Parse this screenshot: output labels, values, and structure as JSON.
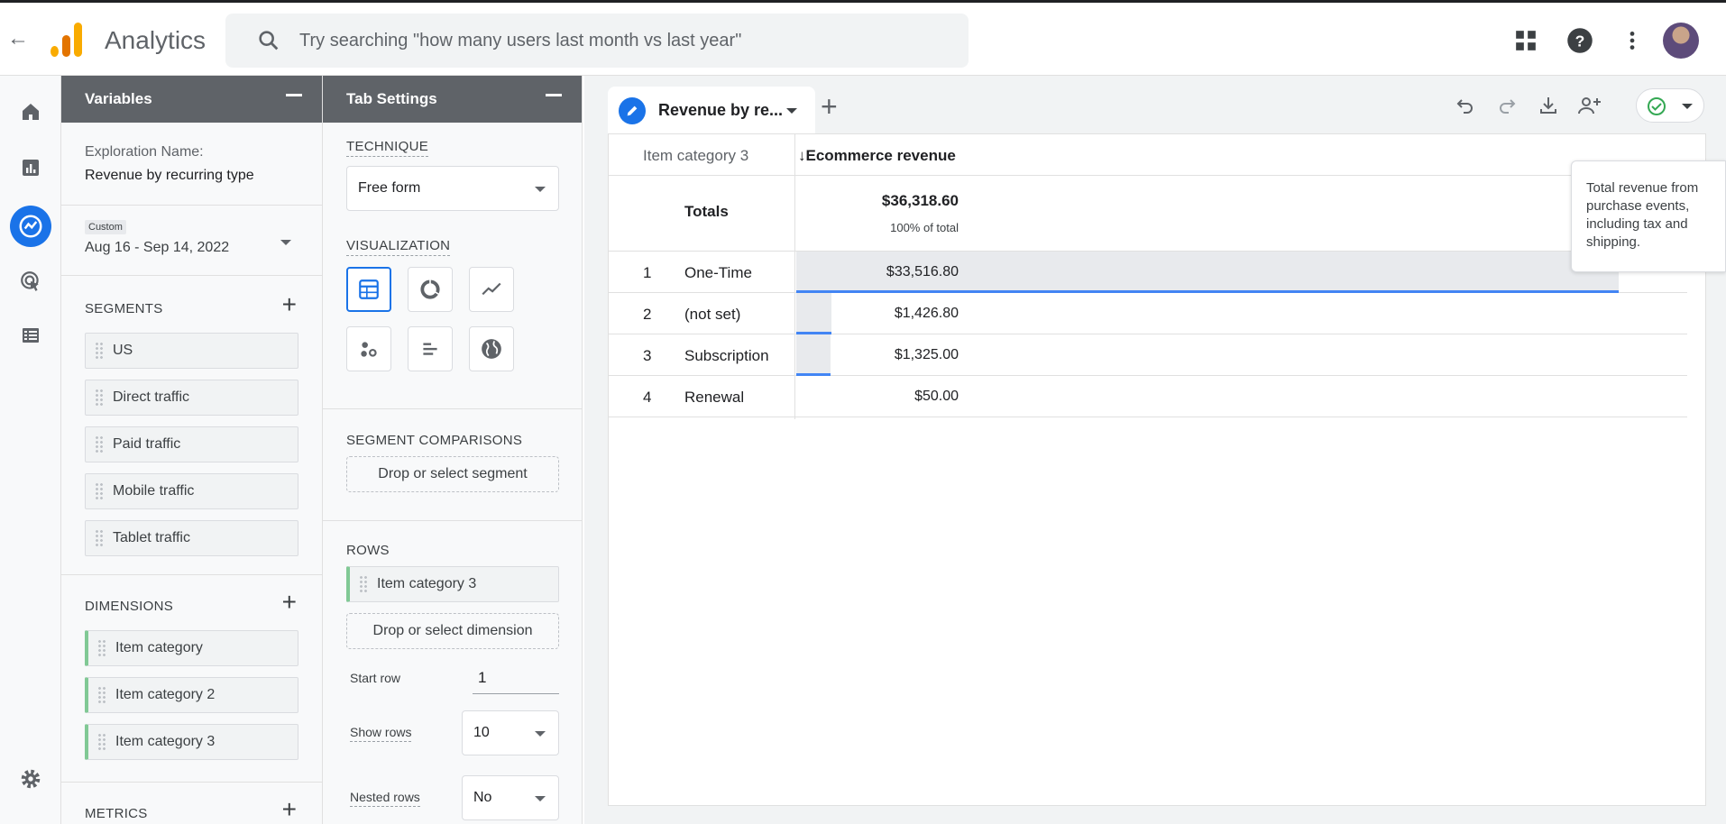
{
  "app": {
    "title": "Analytics"
  },
  "search": {
    "placeholder": "Try searching \"how many users last month vs last year\""
  },
  "variables": {
    "header": "Variables",
    "exploration_name_label": "Exploration Name:",
    "exploration_name": "Revenue by recurring type",
    "date_badge": "Custom",
    "date_range": "Aug 16 - Sep 14, 2022",
    "segments_title": "SEGMENTS",
    "segments": [
      "US",
      "Direct traffic",
      "Paid traffic",
      "Mobile traffic",
      "Tablet traffic"
    ],
    "dimensions_title": "DIMENSIONS",
    "dimensions": [
      "Item category",
      "Item category 2",
      "Item category 3"
    ],
    "metrics_title": "METRICS"
  },
  "tab_settings": {
    "header": "Tab Settings",
    "technique_title": "TECHNIQUE",
    "technique_value": "Free form",
    "visualization_title": "VISUALIZATION",
    "segment_comparisons_title": "SEGMENT COMPARISONS",
    "segment_drop": "Drop or select segment",
    "rows_title": "ROWS",
    "rows_chip": "Item category 3",
    "dimension_drop": "Drop or select dimension",
    "start_row_label": "Start row",
    "start_row_value": "1",
    "show_rows_label": "Show rows",
    "show_rows_value": "10",
    "nested_rows_label": "Nested rows",
    "nested_rows_value": "No"
  },
  "canvas": {
    "tab_label": "Revenue by re...",
    "table": {
      "dimension_header": "Item category 3",
      "metric_header": "↓Ecommerce revenue",
      "totals_label": "Totals",
      "totals_value": "$36,318.60",
      "totals_pct": "100% of total",
      "rows": [
        {
          "num": "1",
          "name": "One-Time",
          "value": "$33,516.80",
          "share": 0.923
        },
        {
          "num": "2",
          "name": "(not set)",
          "value": "$1,426.80",
          "share": 0.039
        },
        {
          "num": "3",
          "name": "Subscription",
          "value": "$1,325.00",
          "share": 0.036
        },
        {
          "num": "4",
          "name": "Renewal",
          "value": "$50.00",
          "share": 0.001
        }
      ]
    },
    "tooltip": "Total revenue from purchase events, including tax and shipping."
  },
  "colors": {
    "accent": "#1a73e8",
    "bar": "#4285f4",
    "chip_stripe": "#81c995",
    "panel_header": "#5f6368"
  }
}
